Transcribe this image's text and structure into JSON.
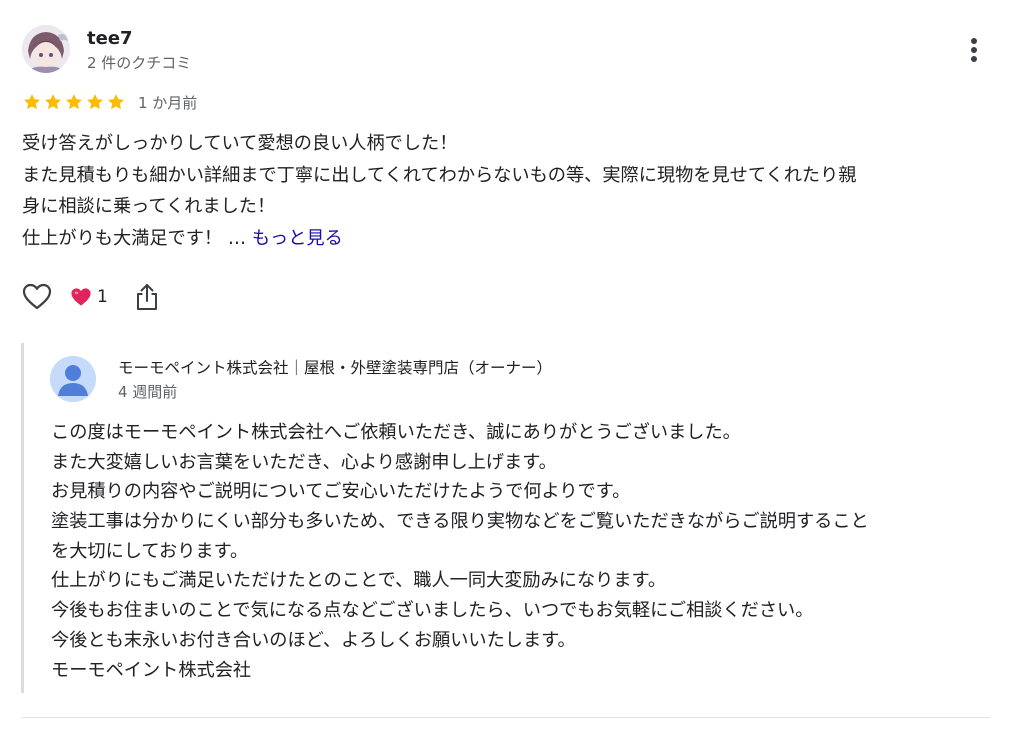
{
  "reviewer": {
    "name": "tee7",
    "meta": "2 件のクチコミ",
    "rating": 5,
    "rating_max": 5,
    "date": "1 か月前"
  },
  "review": {
    "lines": [
      "受け答えがしっかりしていて愛想の良い人柄でした！",
      "また見積もりも細かい詳細まで丁寧に出してくれてわからないもの等、実際に現物を見せてくれたり親",
      "身に相談に乗ってくれました！"
    ],
    "last_line": "仕上がりも大満足です！ … ",
    "more_label": "もっと見る"
  },
  "actions": {
    "reaction_count": "1"
  },
  "reply": {
    "owner_name": "モーモペイント株式会社｜屋根・外壁塗装専門店（オーナー）",
    "date": "4 週間前",
    "lines": [
      "この度はモーモペイント株式会社へご依頼いただき、誠にありがとうございました。",
      "また大変嬉しいお言葉をいただき、心より感謝申し上げます。",
      "お見積りの内容やご説明についてご安心いただけたようで何よりです。",
      "塗装工事は分かりにくい部分も多いため、できる限り実物などをご覧いただきながらご説明すること",
      "を大切にしております。",
      "仕上がりにもご満足いただけたとのことで、職人一同大変励みになります。",
      "今後もお住まいのことで気になる点などございましたら、いつでもお気軽にご相談ください。",
      "今後とも末永いお付き合いのほど、よろしくお願いいたします。",
      "モーモペイント株式会社"
    ]
  },
  "icons": {
    "star": "star-icon",
    "more": "more-vert-icon",
    "like": "heart-outline-icon",
    "reaction": "red-heart-icon",
    "share": "share-icon"
  },
  "colors": {
    "star": "#fbbc04",
    "link": "#1a0dab",
    "secondary_text": "#5f6368",
    "reply_border": "#dadce0",
    "heart": "#e0245e"
  }
}
